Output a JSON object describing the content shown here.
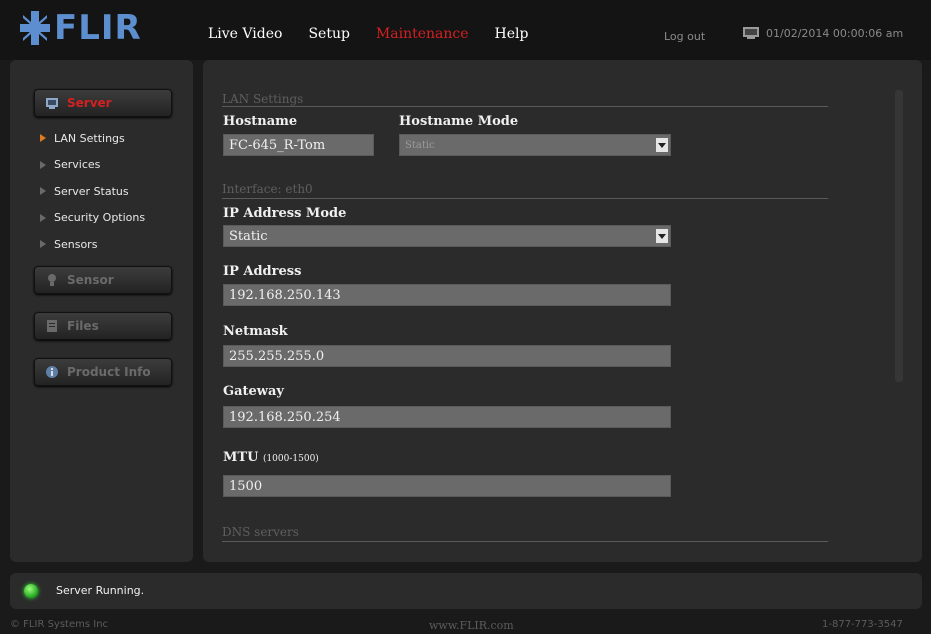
{
  "brand": {
    "logo_text": "FLIR"
  },
  "nav": {
    "items": [
      "Live Video",
      "Setup",
      "Maintenance",
      "Help"
    ],
    "active": "Maintenance",
    "logout": "Log out",
    "datetime": "01/02/2014 00:00:06 am"
  },
  "sidebar": {
    "buttons": {
      "server": "Server",
      "sensor": "Sensor",
      "files": "Files",
      "product_info": "Product Info"
    },
    "subnav": [
      "LAN Settings",
      "Services",
      "Server Status",
      "Security Options",
      "Sensors"
    ],
    "active_subnav": "LAN Settings"
  },
  "lan": {
    "section_title": "LAN Settings",
    "hostname_label": "Hostname",
    "hostname_value": "FC-645_R-Tom",
    "hostname_mode_label": "Hostname Mode",
    "hostname_mode_value": "Static"
  },
  "interface": {
    "section_title": "Interface: eth0",
    "ip_mode_label": "IP Address Mode",
    "ip_mode_value": "Static",
    "ip_label": "IP Address",
    "ip_value": "192.168.250.143",
    "netmask_label": "Netmask",
    "netmask_value": "255.255.255.0",
    "gateway_label": "Gateway",
    "gateway_value": "192.168.250.254",
    "mtu_label": "MTU",
    "mtu_range": "(1000-1500)",
    "mtu_value": "1500"
  },
  "dns": {
    "section_title": "DNS servers"
  },
  "status": {
    "text": "Server Running."
  },
  "footer": {
    "copyright": "© FLIR Systems Inc",
    "website": "www.FLIR.com",
    "phone": "1-877-773-3547"
  },
  "colors": {
    "accent_red": "#d42020",
    "logo_blue": "#5d8fd0",
    "status_green": "#33dd33"
  }
}
